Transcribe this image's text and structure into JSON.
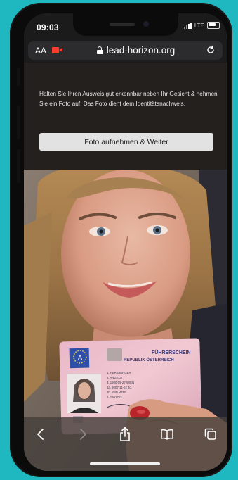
{
  "status_bar": {
    "time": "09:03",
    "network": "LTE"
  },
  "address_bar": {
    "text_size_label": "AA",
    "url": "lead-horizon.org"
  },
  "overlay": {
    "instruction": "Halten Sie Ihren Ausweis gut erkennbar neben Ihr Gesicht & nehmen Sie ein Foto auf. Das Foto dient dem Identitätsnachweis.",
    "button_label": "Foto aufnehmen & Weiter"
  },
  "license_card": {
    "title": "FÜHRERSCHEIN",
    "subtitle": "REPUBLIK ÖSTERREICH",
    "country_code": "A",
    "fields": [
      "1. HERZBERGER",
      "2. ANGELA",
      "3. 1980-05-27 WIEN",
      "4a. 2007-11-02   4c.",
      "4b. BPD WIEN",
      "5. 1601753"
    ]
  },
  "colors": {
    "background": "#1fb8c1",
    "camera_indicator": "#ff3b30",
    "button_bg": "#e2e2e2"
  },
  "toolbar": {
    "icons": [
      "back-icon",
      "forward-icon",
      "share-icon",
      "bookmarks-icon",
      "tabs-icon"
    ]
  }
}
